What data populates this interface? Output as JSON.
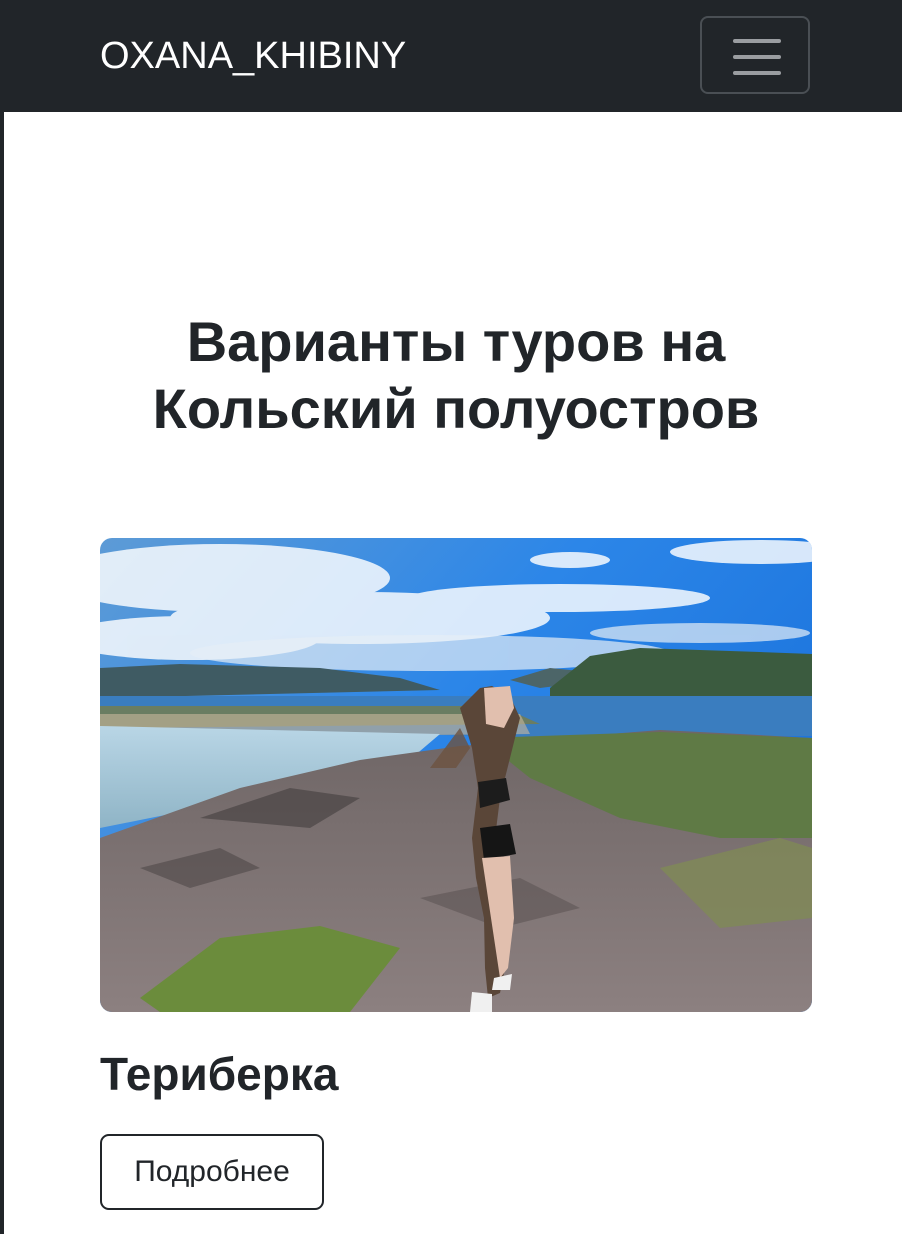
{
  "navbar": {
    "brand": "OXANA_KHIBINY",
    "toggler_icon": "hamburger-menu-icon"
  },
  "main": {
    "title": "Варианты туров на Кольский полуостров"
  },
  "tour_card": {
    "image_description": "photo-teriberka-landscape",
    "title": "Териберка",
    "button_label": "Подробнее"
  },
  "colors": {
    "navbar_bg": "#212529",
    "text": "#212529",
    "page_bg": "#ffffff"
  }
}
